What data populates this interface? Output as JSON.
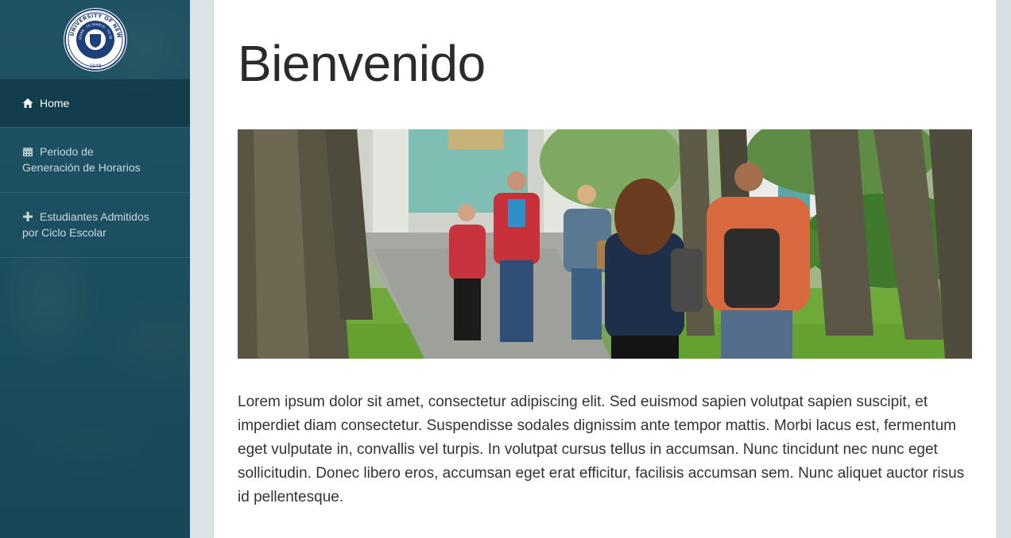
{
  "sidebar": {
    "logo": {
      "icon": "university-seal",
      "ring_text": "STATE UNIVERSITY OF NEW YORK",
      "inner_text": "TO LEARN · TO SEARCH · TO SERVE",
      "year": "1948"
    },
    "items": [
      {
        "label": "Home",
        "icon": "home-icon",
        "active": true
      },
      {
        "label_line1": "Periodo de",
        "label_line2": "Generación de Horarios",
        "icon": "calendar-icon"
      },
      {
        "label_line1": "Estudiantes Admitidos",
        "label_line2": "por Ciclo Escolar",
        "icon": "plus-icon"
      }
    ]
  },
  "main": {
    "title": "Bienvenido",
    "hero": {
      "alt": "students-walking-campus"
    },
    "body": "Lorem ipsum dolor sit amet, consectetur adipiscing elit. Sed euismod sapien volutpat sapien suscipit, et imperdiet diam consectetur. Suspendisse sodales dignissim ante tempor mattis. Morbi lacus est, fermentum eget vulputate in, convallis vel turpis. In volutpat cursus tellus in accumsan. Nunc tincidunt nec nunc eget sollicitudin. Donec libero eros, accumsan eget erat efficitur, facilisis accumsan sem. Nunc aliquet auctor risus id pellentesque."
  },
  "colors": {
    "sidebar": "#1f5566",
    "page_bg": "#dbe3e7",
    "title": "#2b2b2b",
    "text": "#333333"
  }
}
